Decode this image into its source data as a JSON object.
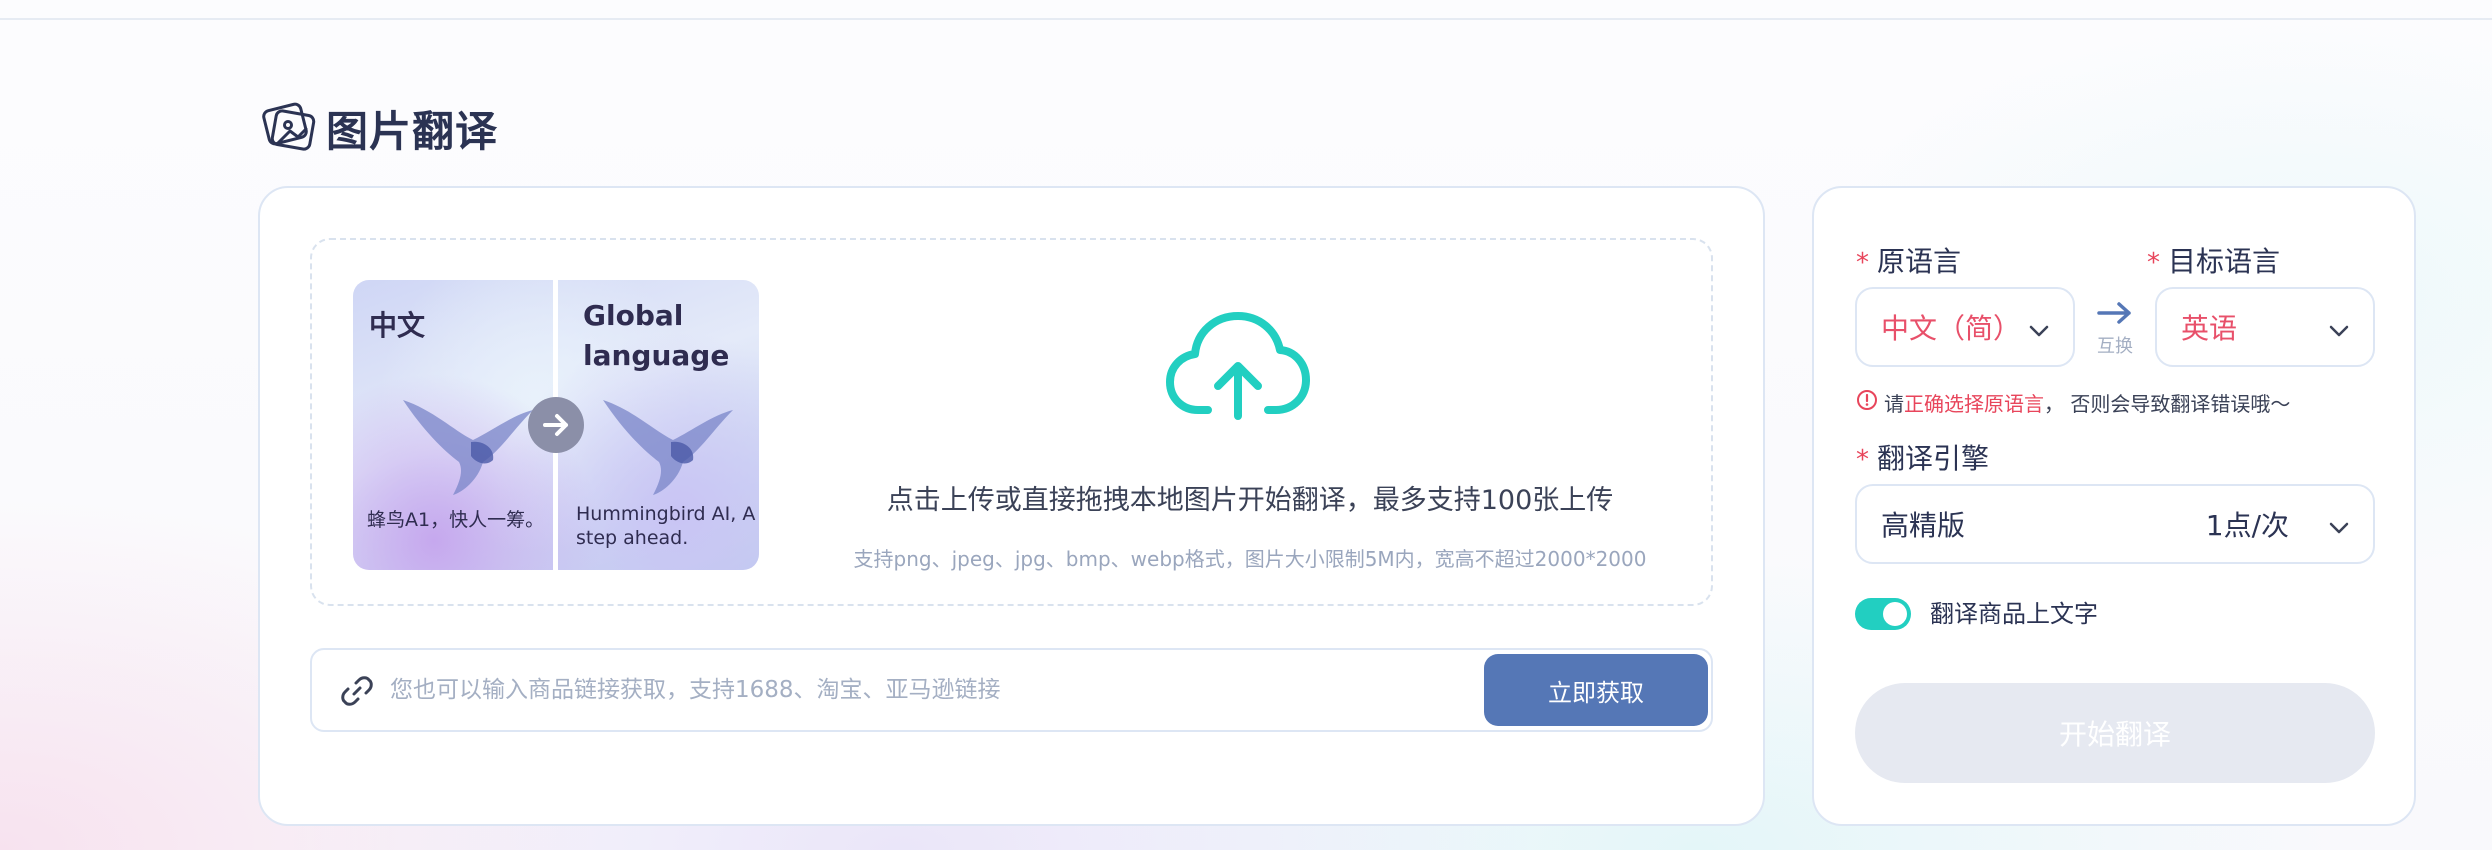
{
  "page": {
    "title": "图片翻译",
    "title_icon": "image-translate-icon"
  },
  "upload": {
    "preview": {
      "left_label": "中文",
      "right_label": "Global language",
      "left_caption": "蜂鸟A1，快人一筹。",
      "right_caption": "Hummingbird AI, A step ahead."
    },
    "hint": "点击上传或直接拖拽本地图片开始翻译，最多支持100张上传",
    "subhint": "支持png、jpeg、jpg、bmp、webp格式，图片大小限制5M内，宽高不超过2000*2000",
    "link_placeholder": "您也可以输入商品链接获取，支持1688、淘宝、亚马逊链接",
    "fetch_label": "立即获取"
  },
  "settings": {
    "required_mark": "*",
    "source_label": "原语言",
    "source_value": "中文（简）",
    "swap_label": "互换",
    "target_label": "目标语言",
    "target_value": "英语",
    "warning_prefix": "请",
    "warning_highlight": "正确选择原语言",
    "warning_suffix": "， 否则会导致翻译错误哦～",
    "engine_label": "翻译引擎",
    "engine_value": "高精版",
    "engine_cost": "1点/次",
    "toggle_label": "翻译商品上文字",
    "toggle_on": true,
    "start_label": "开始翻译"
  },
  "colors": {
    "accent_teal": "#22cfc1",
    "button_blue": "#5577b6",
    "warning_red": "#e8455b",
    "disabled_gray": "#e6e9f1"
  }
}
